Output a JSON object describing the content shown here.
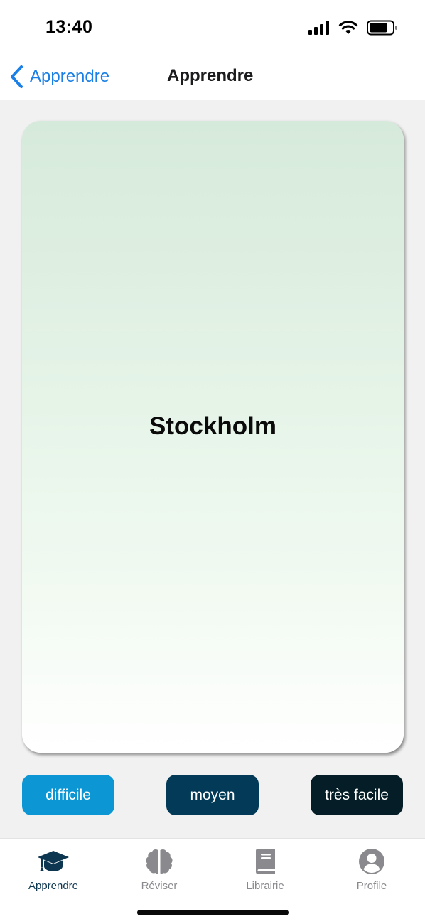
{
  "status_bar": {
    "time": "13:40",
    "icons": [
      "signal-icon",
      "wifi-icon",
      "battery-icon"
    ]
  },
  "nav": {
    "back_label": "Apprendre",
    "title": "Apprendre"
  },
  "card": {
    "word": "Stockholm"
  },
  "rating_buttons": [
    {
      "label": "difficile",
      "color": "#0c97d4"
    },
    {
      "label": "moyen",
      "color": "#023a57"
    },
    {
      "label": "très facile",
      "color": "#041d26"
    }
  ],
  "tabs": [
    {
      "label": "Apprendre",
      "icon": "graduation-cap-icon",
      "active": true
    },
    {
      "label": "Réviser",
      "icon": "brain-icon",
      "active": false
    },
    {
      "label": "Librairie",
      "icon": "book-icon",
      "active": false
    },
    {
      "label": "Profile",
      "icon": "user-circle-icon",
      "active": false
    }
  ],
  "colors": {
    "accent": "#1a7fe6",
    "active_tab": "#0d3650",
    "inactive_tab": "#8a8a8e"
  }
}
